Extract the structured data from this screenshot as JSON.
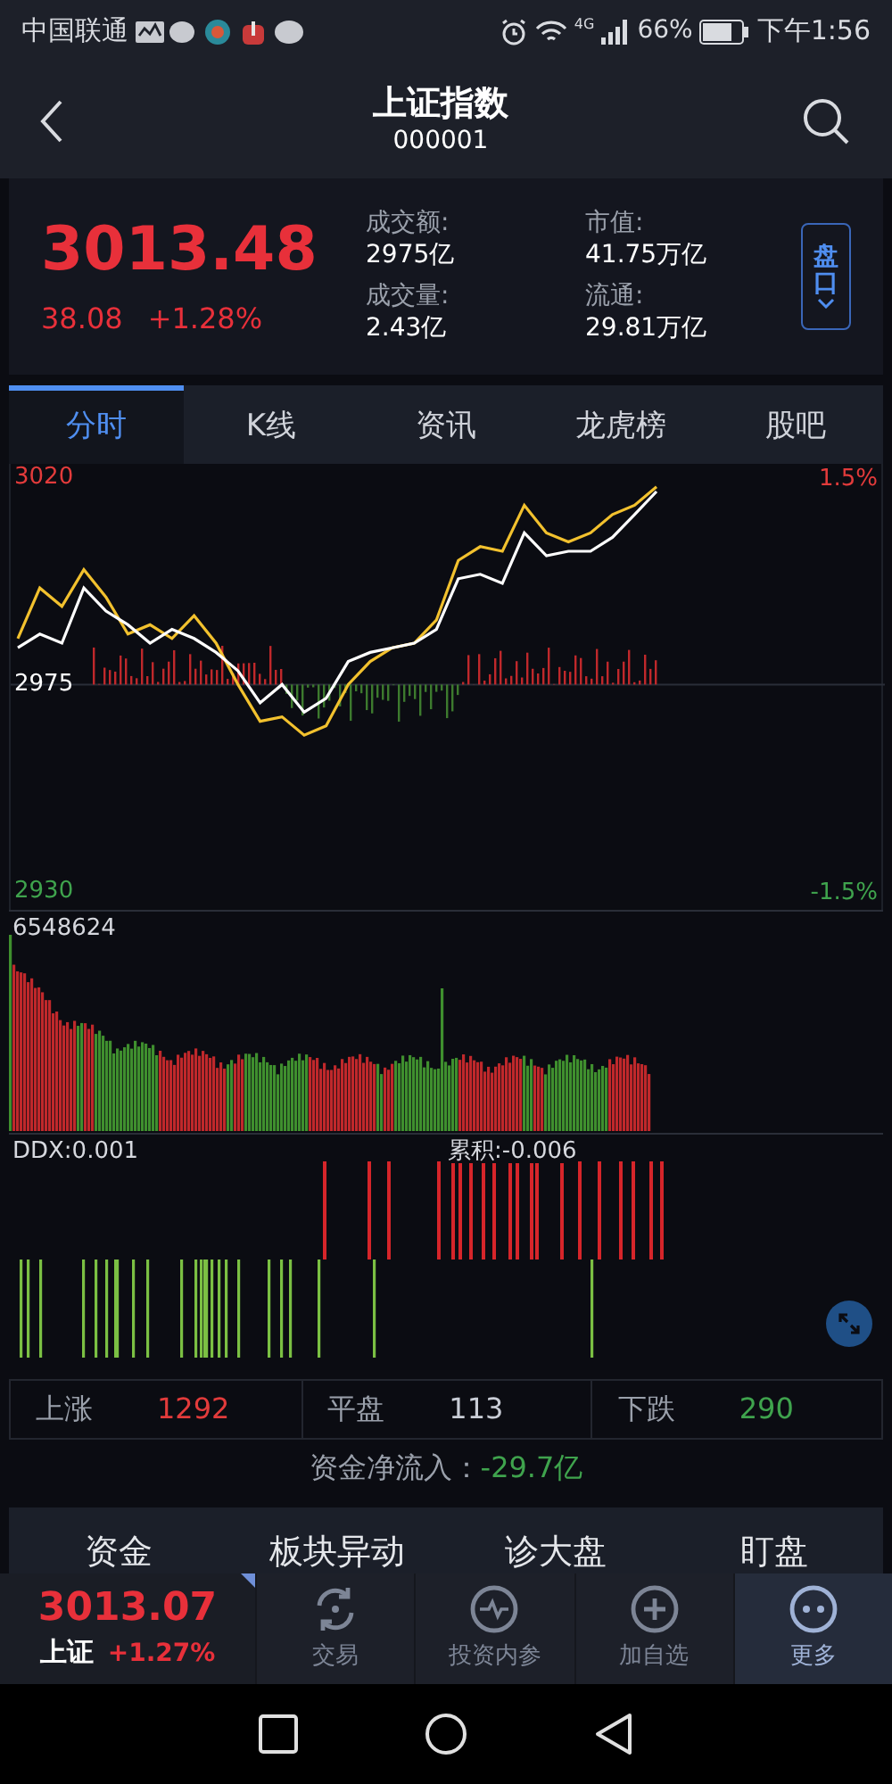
{
  "status_bar": {
    "carrier": "中国联通",
    "network": "4G",
    "battery": "66%",
    "time": "下午1:56"
  },
  "header": {
    "title": "上证指数",
    "code": "000001"
  },
  "quote": {
    "price": "3013.48",
    "change": "38.08",
    "change_pct": "+1.28%",
    "toggle": "盘口",
    "stats": [
      {
        "label": "成交额:",
        "value": "2975亿"
      },
      {
        "label": "市值:",
        "value": "41.75万亿"
      },
      {
        "label": "成交量:",
        "value": "2.43亿"
      },
      {
        "label": "流通:",
        "value": "29.81万亿"
      }
    ]
  },
  "tabs": [
    {
      "label": "分时",
      "selected": true
    },
    {
      "label": "K线",
      "selected": false
    },
    {
      "label": "资讯",
      "selected": false
    },
    {
      "label": "龙虎榜",
      "selected": false
    },
    {
      "label": "股吧",
      "selected": false
    }
  ],
  "price_chart": {
    "right_labels": [
      "1.5%",
      "-1.5%"
    ],
    "chart_data": {
      "type": "line",
      "ylim": [
        2926,
        3023
      ],
      "yticks": [
        2930,
        2975,
        3020
      ],
      "categories": [
        null,
        null,
        null,
        null,
        null,
        null,
        null,
        null,
        null,
        null,
        null,
        null,
        null,
        null,
        null,
        null,
        null,
        null,
        null,
        null,
        null,
        null,
        null,
        null,
        null,
        null,
        null,
        null,
        null,
        null
      ],
      "series": [
        {
          "color": "#f2c12e",
          "values": [
            2985,
            2996,
            2992,
            3000,
            2994,
            2986,
            2988,
            2985,
            2990,
            2984,
            2975,
            2967,
            2968,
            2964,
            2966,
            2975,
            2980,
            2983,
            2984,
            2989,
            3002,
            3005,
            3004,
            3014,
            3008,
            3006,
            3008,
            3012,
            3014,
            3018
          ]
        },
        {
          "color": "#ffffff",
          "values": [
            2983,
            2986,
            2984,
            2996,
            2991,
            2988,
            2984,
            2987,
            2985,
            2982,
            2978,
            2971,
            2975,
            2969,
            2972,
            2980,
            2982,
            2983,
            2984,
            2987,
            2998,
            2999,
            2997,
            3008,
            3003,
            3004,
            3004,
            3007,
            3012,
            3017
          ]
        }
      ]
    }
  },
  "volume_chart": {
    "max_label": "6548624"
  },
  "ddx_chart": {
    "ddx": "DDX:0.001",
    "cumulative": "累积:-0.006"
  },
  "breadth": [
    {
      "label": "上涨",
      "value": "1292",
      "color": "#e23b3b"
    },
    {
      "label": "平盘",
      "value": "113",
      "color": "#c9cdd6"
    },
    {
      "label": "下跌",
      "value": "290",
      "color": "#3fa34d"
    }
  ],
  "fund_flow": {
    "label": "资金净流入：",
    "value": "-29.7亿"
  },
  "shortcuts": [
    "资金",
    "板块异动",
    "诊大盘",
    "盯盘"
  ],
  "bottom_quote": {
    "price": "3013.07",
    "name": "上证",
    "change_pct": "+1.27%"
  },
  "bottom_nav": [
    {
      "label": "交易",
      "kind": "refresh",
      "selected": false
    },
    {
      "label": "投资内参",
      "kind": "pulse",
      "selected": false
    },
    {
      "label": "加自选",
      "kind": "plus",
      "selected": false
    },
    {
      "label": "更多",
      "kind": "dots",
      "selected": true
    }
  ]
}
